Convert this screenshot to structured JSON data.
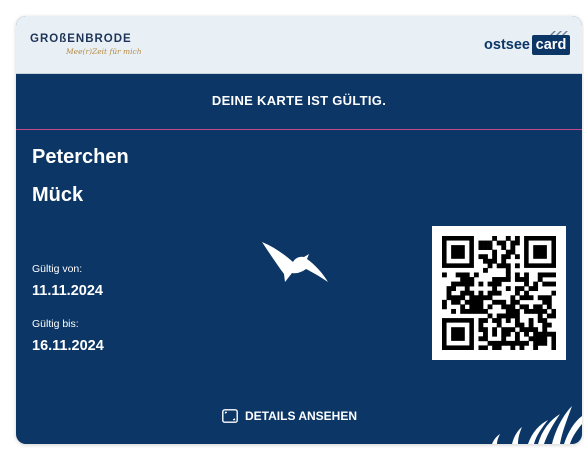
{
  "header": {
    "brand_left": "GROßENBRODE",
    "tagline_left": "Mee(r)Zeit für mich",
    "brand_right_word": "ostsee",
    "brand_right_box": "card"
  },
  "status": {
    "text": "DEINE KARTE IST GÜLTIG."
  },
  "holder": {
    "first_name": "Peterchen",
    "last_name": "Mück"
  },
  "validity": {
    "from_label": "Gültig von:",
    "from_value": "11.11.2024",
    "to_label": "Gültig bis:",
    "to_value": "16.11.2024"
  },
  "actions": {
    "details_label": "DETAILS ANSEHEN"
  },
  "colors": {
    "card_background": "#0b3666",
    "header_background": "#e9f0f5",
    "status_divider": "#c34a8a"
  },
  "icons": {
    "seagull": "seagull-icon",
    "qr": "qr-code",
    "details": "expand-icon",
    "grass": "beach-grass-icon"
  }
}
